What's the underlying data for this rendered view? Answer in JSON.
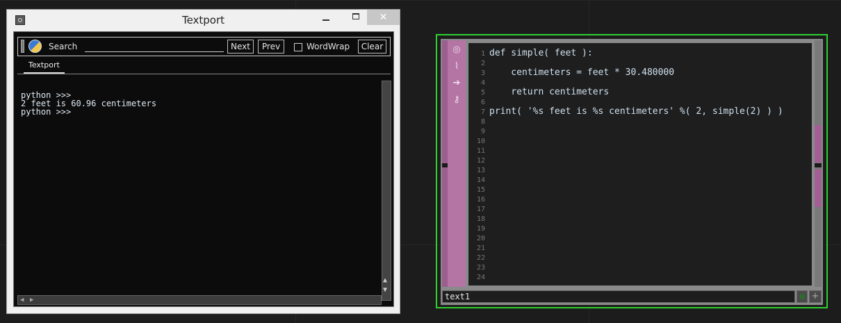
{
  "textport_window": {
    "title": "Textport",
    "close_glyph": "✕",
    "toolbar": {
      "search_label": "Search",
      "search_value": "",
      "next_label": "Next",
      "prev_label": "Prev",
      "wordwrap_label": "WordWrap",
      "wordwrap_checked": false,
      "clear_label": "Clear"
    },
    "tabs": [
      {
        "label": "Textport",
        "active": true
      }
    ],
    "console_lines": [
      "python >>>",
      "2 feet is 60.96 centimeters",
      "python >>>"
    ]
  },
  "text_dat": {
    "name": "text1",
    "border_color": "#2fd12f",
    "accent_color": "#b474a4",
    "side_icons": [
      "target-icon",
      "pulse-icon",
      "arrow-right-icon",
      "key-icon"
    ],
    "code_lines": [
      "def simple( feet ):",
      "",
      "    centimeters = feet * 30.480000",
      "",
      "    return centimeters",
      "",
      "print( '%s feet is %s centimeters' %( 2, simple(2) ) )"
    ],
    "line_numbers": [
      "1",
      "2",
      "3",
      "4",
      "5",
      "6",
      "7",
      "8",
      "9",
      "10",
      "11",
      "12",
      "13",
      "14",
      "15",
      "16",
      "17",
      "18",
      "19",
      "20",
      "21",
      "22",
      "23",
      "24"
    ]
  }
}
